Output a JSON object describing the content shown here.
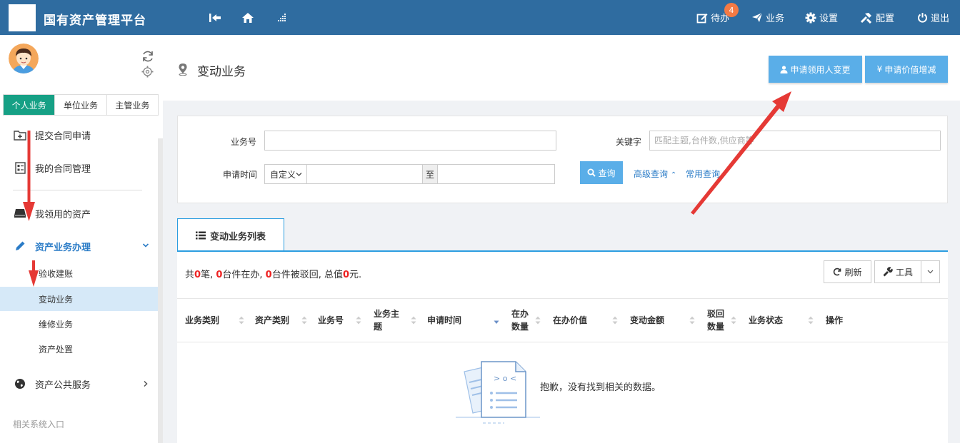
{
  "header": {
    "app_title": "国有资产管理平台",
    "todo_label": "待办",
    "todo_count": "4",
    "business_label": "业务",
    "settings_label": "设置",
    "config_label": "配置",
    "logout_label": "退出",
    "brand_color": "#2f6ca0"
  },
  "sidebar": {
    "tabs": [
      "个人业务",
      "单位业务",
      "主管业务"
    ],
    "items": {
      "submit_contract": "提交合同申请",
      "my_contracts": "我的合同管理",
      "my_assets": "我领用的资产",
      "asset_business": "资产业务办理",
      "acceptance": "验收建账",
      "change": "变动业务",
      "repair": "维修业务",
      "disposal": "资产处置",
      "public_service": "资产公共服务"
    },
    "related_title": "相关系统入口"
  },
  "page": {
    "title": "变动业务",
    "btn_change_user": "申请领用人变更",
    "btn_change_value": "申请价值增减"
  },
  "search": {
    "biz_no_label": "业务号",
    "keyword_label": "关键字",
    "keyword_placeholder": "匹配主题,台件数,供应商等",
    "date_label": "申请时间",
    "date_mode": "自定义",
    "to_label": "至",
    "search_btn": "查询",
    "advanced_link": "高级查询",
    "common_link": "常用查询"
  },
  "list": {
    "tab_title": "变动业务列表",
    "summary": {
      "p1": "共",
      "total_count": "0",
      "p2": "笔, ",
      "in_progress": "0",
      "p3": "台件在办, ",
      "rejected": "0",
      "p4": "台件被驳回, 总值",
      "total_value": "0",
      "p5": "元."
    },
    "refresh_btn": "刷新",
    "tools_btn": "工具",
    "columns": {
      "c1": "业务类别",
      "c2": "资产类别",
      "c3": "业务号",
      "c4a": "业务主",
      "c4b": "题",
      "c5": "申请时间",
      "c6a": "在办",
      "c6b": "数量",
      "c7": "在办价值",
      "c8": "变动金额",
      "c9a": "驳回",
      "c9b": "数量",
      "c10": "业务状态",
      "c11": "操作"
    },
    "empty_message": "抱歉，没有找到相关的数据。"
  }
}
